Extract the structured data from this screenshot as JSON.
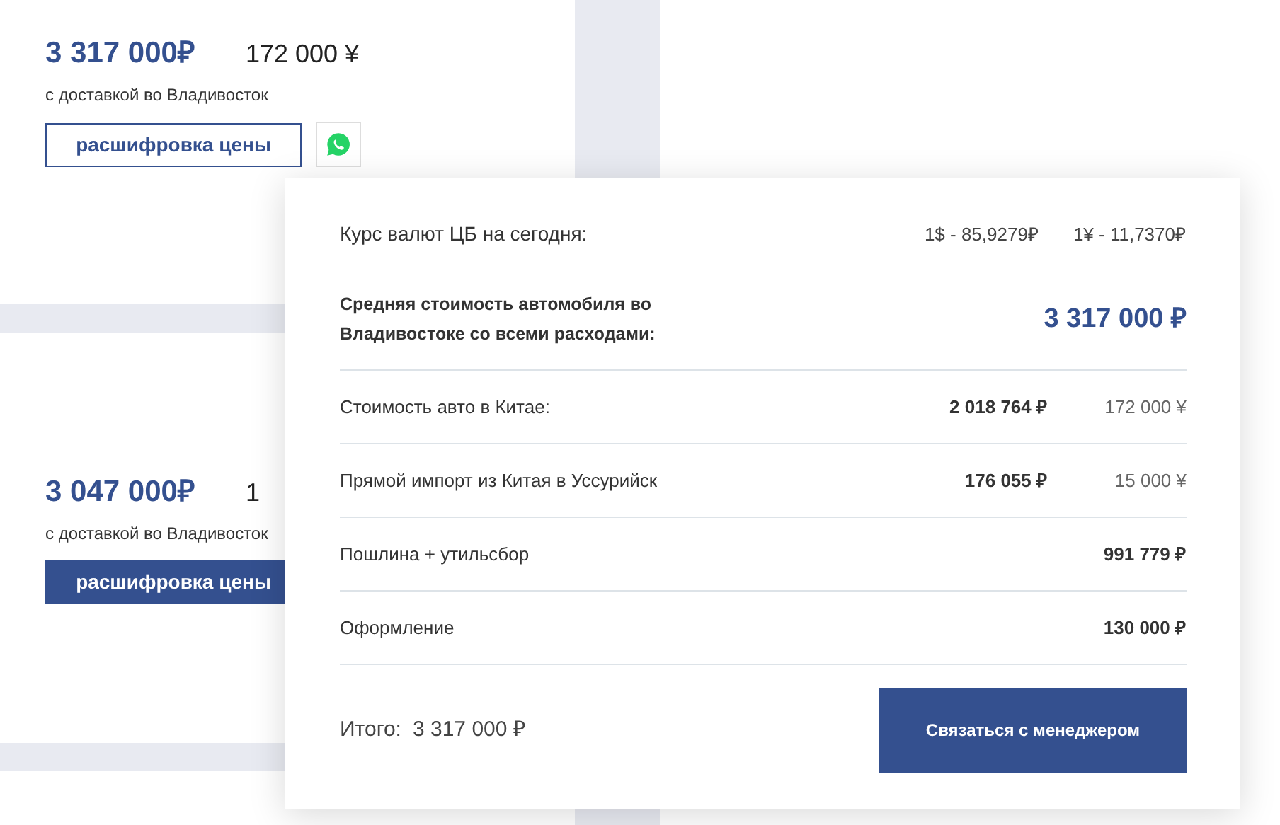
{
  "cards": [
    {
      "price": "3 317 000₽",
      "price_cny": "172 000 ¥",
      "delivery": "с доставкой во Владивосток",
      "button": {
        "label": "расшифровка цены",
        "kind": "outline"
      },
      "whatsapp": true
    },
    {
      "price": "3 047 000₽",
      "price_cny": "1",
      "delivery": "с доставкой во Владивосток",
      "button": {
        "label": "расшифровка цены",
        "kind": "filled"
      }
    }
  ],
  "popup": {
    "rate_label": "Курс валют ЦБ на сегодня:",
    "rates": [
      "1$ - 85,9279₽",
      "1¥ - 11,7370₽"
    ],
    "average_label": "Средняя стоимость автомобиля во Владивостоке со всеми расходами:",
    "average_value": "3 317 000 ₽",
    "items": [
      {
        "label": "Стоимость авто в Китае:",
        "rub": "2 018 764 ₽",
        "cny": "172 000 ¥"
      },
      {
        "label": "Прямой импорт из Китая в Уссурийск",
        "rub": "176 055 ₽",
        "cny": "15 000 ¥"
      },
      {
        "label": "Пошлина + утильсбор",
        "rub": "991 779 ₽"
      },
      {
        "label": "Оформление",
        "rub": "130 000 ₽"
      }
    ],
    "total_label": "Итого:",
    "total_value": "3 317 000 ₽",
    "contact_button": "Связаться с менеджером"
  }
}
